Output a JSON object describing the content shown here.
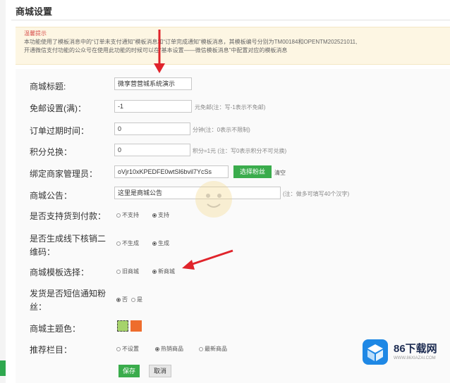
{
  "page": {
    "title": "商城设置"
  },
  "notice": {
    "title": "温馨提示",
    "line1": "本功能使用了模板消息中的“订单未支付通知”模板消息和“订单完成通知”模板消息，其模板编号分别为TM00184和OPENTM202521011,",
    "line2": "开通微信支付功能的公众号在使用此功能的时候可以在“基本设置——微信模板消息”中配置对应的模板消息"
  },
  "form": {
    "shop_title": {
      "label": "商城标题:",
      "value": "微享营营城系统演示"
    },
    "free_shipping": {
      "label": "免邮设置(满)：",
      "value": "-1",
      "hint": "元免邮(注：写-1表示不免邮)"
    },
    "order_expire": {
      "label": "订单过期时间：",
      "value": "0",
      "hint": "分钟(注：0表示不限制)"
    },
    "points": {
      "label": "积分兑换：",
      "value": "0",
      "hint": "积分=1元 (注：写0表示积分不可兑换)"
    },
    "bind_admin": {
      "label": "绑定商家管理员：",
      "value": "oVjr10xKPEDFE0wtSl6bvil7YcSs",
      "select_label": "选择粉丝",
      "clear_label": "清空"
    },
    "announcement": {
      "label": "商城公告：",
      "value": "这里是商城公告",
      "hint": "(注：做多可填写40个汉字)"
    },
    "cod": {
      "label": "是否支持货到付款：",
      "options": [
        "不支持",
        "支持"
      ],
      "selected": 1
    },
    "offline_qr": {
      "label": "是否生成线下核销二维码：",
      "options": [
        "不生成",
        "生成"
      ],
      "selected": 1
    },
    "template": {
      "label": "商城模板选择：",
      "options": [
        "旧商城",
        "新商城"
      ],
      "selected": 1
    },
    "sms_notify": {
      "label": "发货是否短信通知粉丝：",
      "options": [
        "否",
        "是"
      ],
      "selected": 0
    },
    "theme_color": {
      "label": "商城主题色：",
      "colors": [
        "#a6d36b",
        "#ee6d2d"
      ]
    },
    "recommend": {
      "label": "推荐栏目：",
      "options": [
        "不设置",
        "热销商品",
        "最新商品"
      ],
      "selected": 1
    },
    "save_label": "保存",
    "cancel_label": "取消"
  },
  "logo": {
    "text": "86下载网",
    "sub": "WWW.86XIAZAI.COM"
  },
  "colors": {
    "accent_green": "#3aac4c",
    "notice_bg": "#fdf6e3",
    "notice_title": "#d9534f"
  }
}
